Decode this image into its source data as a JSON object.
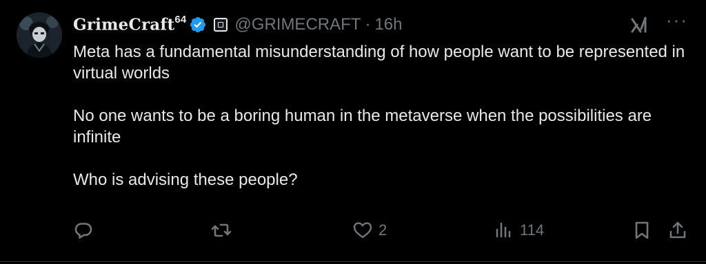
{
  "author": {
    "display_name": "GrimeCraft",
    "display_name_sup": "64",
    "verified_icon": "verified-badge-icon",
    "affiliate_icon": "affiliate-badge-icon",
    "handle": "@GRIMECRAFT",
    "separator": "·",
    "time": "16h"
  },
  "top_actions": {
    "grok_icon": "grok-icon",
    "more_label": "···"
  },
  "tweet": {
    "paragraphs": [
      "Meta has a fundamental misunderstanding of how people want to be represented in virtual worlds",
      "No one wants to be a boring human in the metaverse when the possibilities are infinite",
      "Who is advising these people?"
    ]
  },
  "actions": {
    "reply_count": "",
    "retweet_count": "",
    "like_count": "2",
    "views_count": "114"
  },
  "colors": {
    "background": "#000000",
    "text": "#e7e9ea",
    "muted": "#71767b",
    "verified": "#1d9bf0"
  }
}
